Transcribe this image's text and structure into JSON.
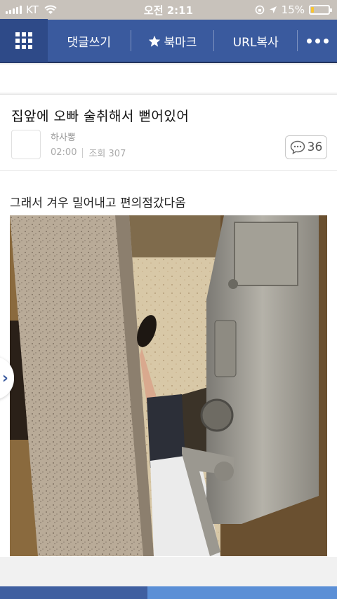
{
  "status_bar": {
    "carrier": "KT",
    "time": "오전 2:11",
    "battery": "15%",
    "battery_level": 0.15
  },
  "nav": {
    "comment_write": "댓글쓰기",
    "bookmark": "북마크",
    "url_copy": "URL복사"
  },
  "post": {
    "title": "집앞에 오빠 술취해서 뻗어있어",
    "author": "하사뽕",
    "time": "02:00",
    "views": "조회 307",
    "comment_count": "36",
    "body": "그래서 겨우 밀어내고 편의점갔다옴"
  },
  "side_arrow": "›"
}
